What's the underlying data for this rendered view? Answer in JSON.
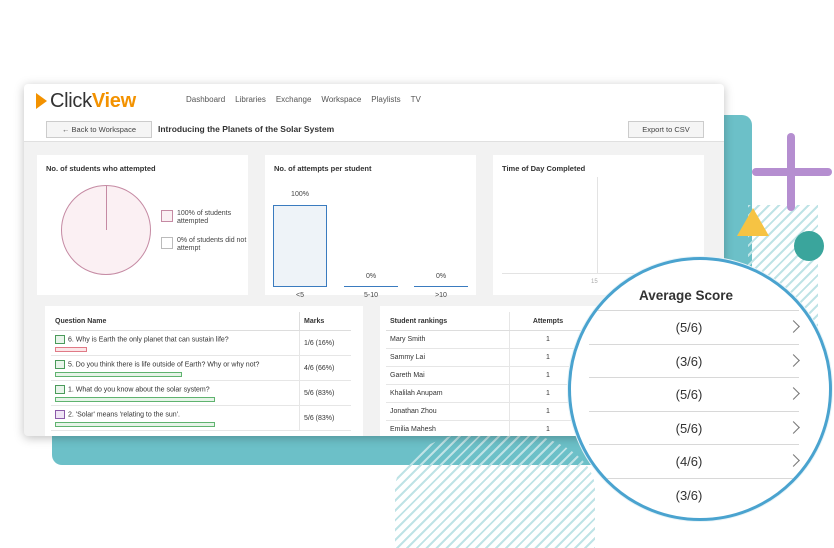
{
  "app": {
    "logo_part1": "Click",
    "logo_part2": "View",
    "brand_color": "#f39200"
  },
  "nav": [
    "Dashboard",
    "Libraries",
    "Exchange",
    "Workspace",
    "Playlists",
    "TV"
  ],
  "subbar": {
    "back_label": "← Back to Workspace",
    "title": "Introducing the Planets of the Solar System",
    "export_label": "Export to CSV"
  },
  "attempted_card": {
    "title": "No. of students who attempted",
    "legend": [
      {
        "text": "100% of students attempted",
        "color": "#fbf0f3"
      },
      {
        "text": "0% of students did not attempt",
        "color": "#ffffff"
      }
    ]
  },
  "attempts_card": {
    "title": "No. of attempts per student"
  },
  "time_card": {
    "title": "Time of Day Completed",
    "tick": "15"
  },
  "chart_data": {
    "type": "bar",
    "categories": [
      "<5",
      "5-10",
      ">10"
    ],
    "values": [
      100,
      0,
      0
    ],
    "data_labels": [
      "100%",
      "0%",
      "0%"
    ],
    "ylim": [
      0,
      100
    ]
  },
  "questions": {
    "headers": [
      "Question Name",
      "Marks"
    ],
    "rows": [
      {
        "name": "6. Why is Earth the only planet that can sustain life?",
        "marks": "1/6 (16%)",
        "fraction": 0.16,
        "type": "text"
      },
      {
        "name": "5. Do you think there is life outside of Earth? Why or why not?",
        "marks": "4/6 (66%)",
        "fraction": 0.66,
        "type": "text"
      },
      {
        "name": "1. What do you know about the solar system?",
        "marks": "5/6 (83%)",
        "fraction": 0.83,
        "type": "text"
      },
      {
        "name": "2. 'Solar' means 'relating to the sun'.",
        "marks": "5/6 (83%)",
        "fraction": 0.83,
        "type": "choice"
      }
    ]
  },
  "rankings": {
    "headers": [
      "Student rankings",
      "Attempts"
    ],
    "rows": [
      {
        "name": "Mary Smith",
        "attempts": "1"
      },
      {
        "name": "Sammy Lai",
        "attempts": "1"
      },
      {
        "name": "Gareth Mai",
        "attempts": "1"
      },
      {
        "name": "Khalilah Anupam",
        "attempts": "1"
      },
      {
        "name": "Jonathan Zhou",
        "attempts": "1"
      },
      {
        "name": "Emilia Mahesh",
        "attempts": "1"
      }
    ]
  },
  "average_score": {
    "title": "Average Score",
    "rows": [
      "(5/6)",
      "(3/6)",
      "(5/6)",
      "(5/6)",
      "(4/6)",
      "(3/6)"
    ]
  }
}
